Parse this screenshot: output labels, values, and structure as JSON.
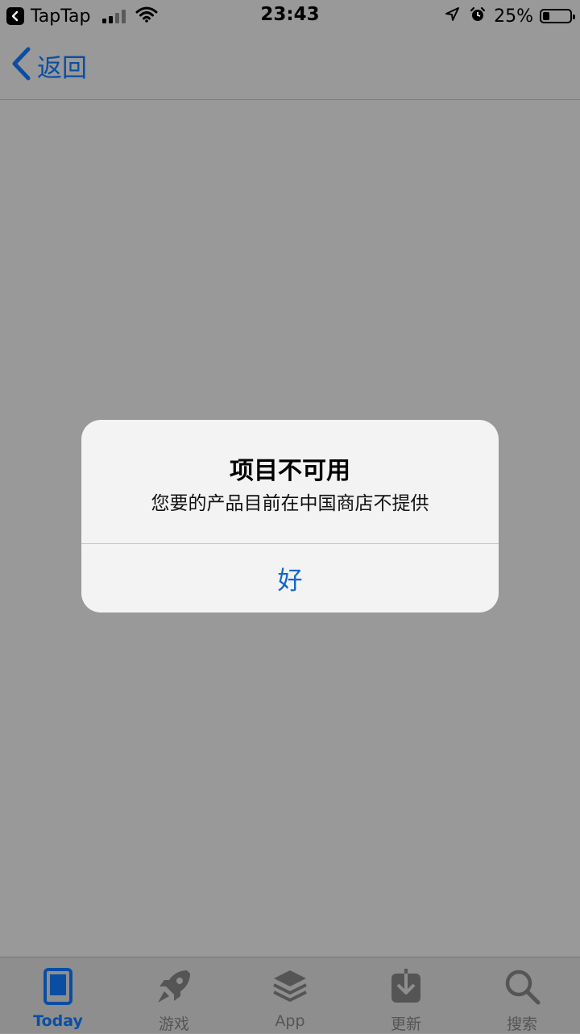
{
  "status_bar": {
    "back_app": "TapTap",
    "time": "23:43",
    "battery_percent": "25%",
    "battery_level": 0.25
  },
  "nav": {
    "back_label": "返回"
  },
  "alert": {
    "title": "项目不可用",
    "message": "您要的产品目前在中国商店不提供",
    "ok_label": "好"
  },
  "tabs": [
    {
      "label": "Today",
      "icon": "today-icon",
      "active": true
    },
    {
      "label": "游戏",
      "icon": "rocket-icon",
      "active": false
    },
    {
      "label": "App",
      "icon": "layers-icon",
      "active": false
    },
    {
      "label": "更新",
      "icon": "download-icon",
      "active": false
    },
    {
      "label": "搜索",
      "icon": "search-icon",
      "active": false
    }
  ],
  "colors": {
    "accent": "#0a4ea3",
    "alert_button": "#1067c9",
    "dim_background": "#999999"
  }
}
